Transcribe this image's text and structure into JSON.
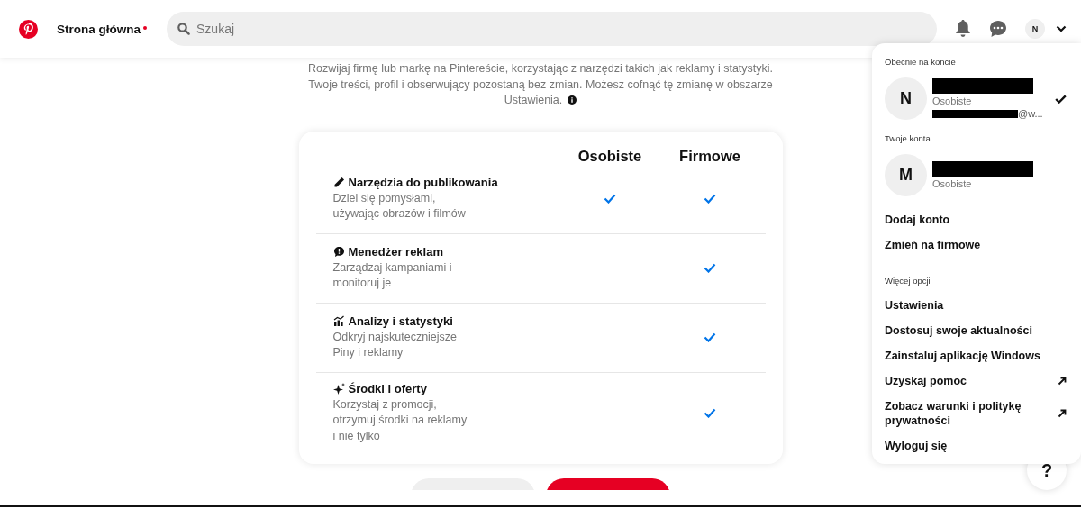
{
  "header": {
    "home": {
      "label": "Strona główna",
      "notification_dot": true
    },
    "search": {
      "placeholder": "Szukaj"
    },
    "avatar": "N"
  },
  "intro": {
    "lines": [
      "Rozwijaj firmę lub markę na Pintereście, korzystając z narzędzi takich jak reklamy i statystyki.",
      "Twoje treści, profil i obserwujący pozostaną bez zmian. Możesz cofnąć tę zmianę w obszarze",
      "Ustawienia."
    ]
  },
  "comparison": {
    "columns": [
      "Osobiste",
      "Firmowe"
    ],
    "rows": [
      {
        "kind": "pencil",
        "title": "Narzędzia do publikowania",
        "description": [
          "Dziel się pomysłami,",
          "używając obrazów i filmów"
        ],
        "personal": true,
        "business": true
      },
      {
        "kind": "ads",
        "title": "Menedżer reklam",
        "description": [
          "Zarządzaj kampaniami i",
          "monitoruj je"
        ],
        "personal": false,
        "business": true
      },
      {
        "kind": "chart",
        "title": "Analizy i statystyki",
        "description": [
          "Odkryj najskuteczniejsze",
          "Piny i reklamy"
        ],
        "personal": false,
        "business": true
      },
      {
        "kind": "sparkle",
        "title": "Środki i oferty",
        "description": [
          "Korzystaj z promocji,",
          "otrzymuj środki na reklamy",
          "i nie tylko"
        ],
        "personal": false,
        "business": true
      }
    ]
  },
  "account_menu": {
    "current_heading": "Obecnie na koncie",
    "current": {
      "initial": "N",
      "name_redacted": true,
      "type": "Osobiste",
      "email": "@w...",
      "email_redacted": true,
      "selected": true
    },
    "accounts_heading": "Twoje konta",
    "accounts": [
      {
        "initial": "M",
        "name_redacted": true,
        "type": "Osobiste",
        "selected": false
      }
    ],
    "actions": [
      {
        "label": "Dodaj konto",
        "external": false
      },
      {
        "label": "Zmień na firmowe",
        "external": false
      }
    ],
    "more_heading": "Więcej opcji",
    "more": [
      {
        "label": "Ustawienia",
        "external": false
      },
      {
        "label": "Dostosuj swoje aktualności",
        "external": false
      },
      {
        "label": "Zainstaluj aplikację Windows",
        "external": false
      },
      {
        "label": "Uzyskaj pomoc",
        "external": true
      },
      {
        "label": "Zobacz warunki i politykę prywatności",
        "external": true
      },
      {
        "label": "Wyloguj się",
        "external": false
      }
    ]
  },
  "help_button": "?"
}
